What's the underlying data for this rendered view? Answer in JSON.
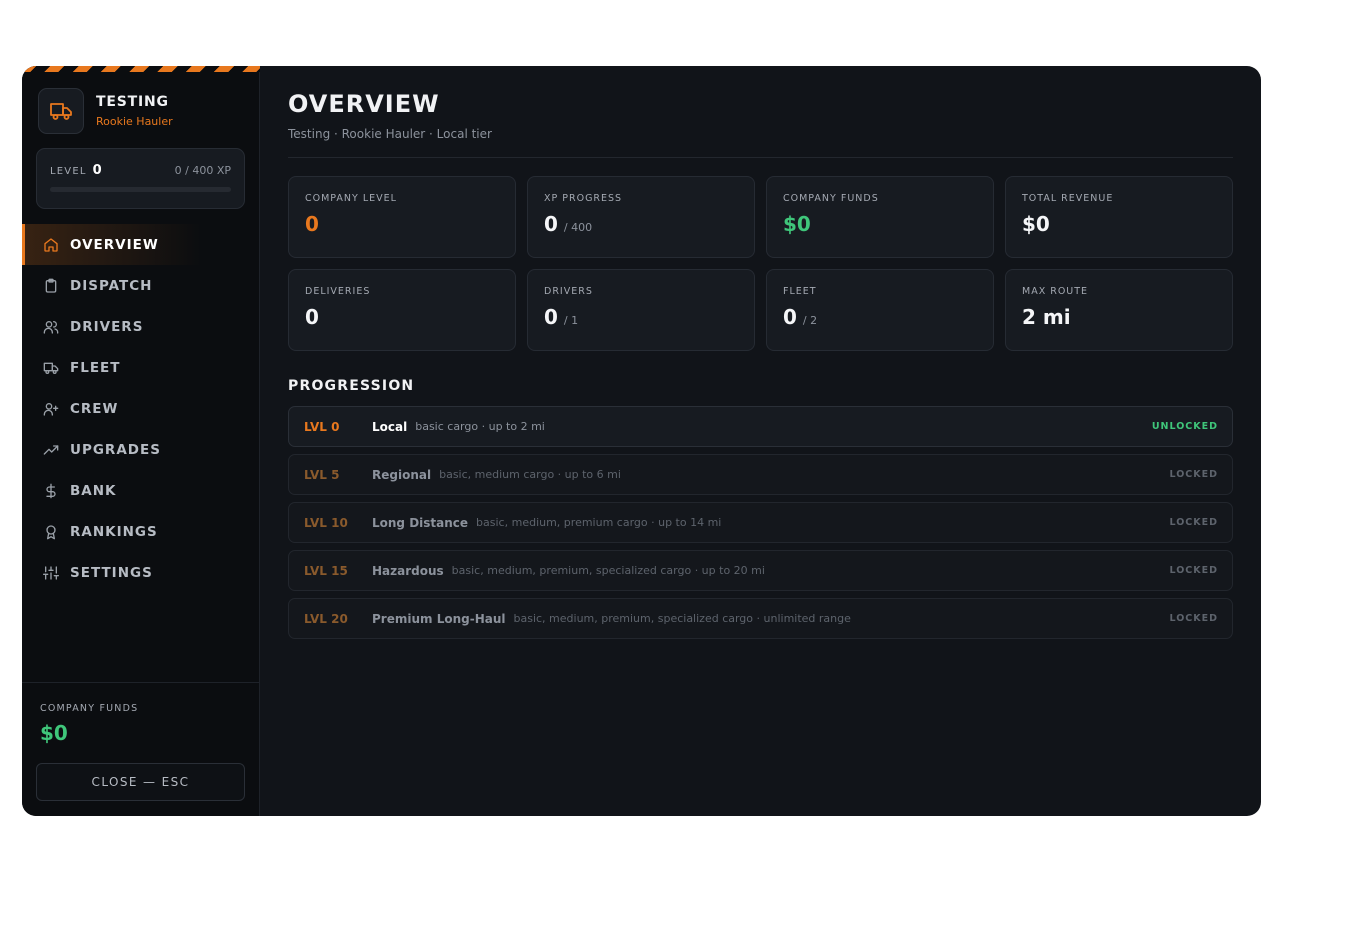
{
  "brand": {
    "name": "TESTING",
    "rank": "Rookie Hauler",
    "icon": "truck-icon"
  },
  "level": {
    "label": "LEVEL",
    "value": "0",
    "xp": "0 / 400 XP",
    "progress": 0
  },
  "nav": [
    {
      "label": "OVERVIEW",
      "icon": "home-icon",
      "active": true
    },
    {
      "label": "DISPATCH",
      "icon": "clipboard-icon"
    },
    {
      "label": "DRIVERS",
      "icon": "users-icon"
    },
    {
      "label": "FLEET",
      "icon": "truck-icon"
    },
    {
      "label": "CREW",
      "icon": "user-plus-icon"
    },
    {
      "label": "UPGRADES",
      "icon": "trending-up-icon"
    },
    {
      "label": "BANK",
      "icon": "dollar-icon"
    },
    {
      "label": "RANKINGS",
      "icon": "award-icon"
    },
    {
      "label": "SETTINGS",
      "icon": "sliders-icon"
    }
  ],
  "sidebar_footer": {
    "funds_label": "COMPANY FUNDS",
    "funds_value": "$0",
    "close_label": "CLOSE — ESC"
  },
  "page": {
    "title": "OVERVIEW",
    "subtitle": "Testing · Rookie Hauler · Local tier"
  },
  "stats": [
    {
      "label": "COMPANY LEVEL",
      "value": "0",
      "suffix": ""
    },
    {
      "label": "XP PROGRESS",
      "value": "0",
      "suffix": "/ 400"
    },
    {
      "label": "COMPANY FUNDS",
      "value": "$0",
      "suffix": ""
    },
    {
      "label": "TOTAL REVENUE",
      "value": "$0",
      "suffix": ""
    },
    {
      "label": "DELIVERIES",
      "value": "0",
      "suffix": ""
    },
    {
      "label": "DRIVERS",
      "value": "0",
      "suffix": "/ 1"
    },
    {
      "label": "FLEET",
      "value": "0",
      "suffix": "/ 2"
    },
    {
      "label": "MAX ROUTE",
      "value": "2 mi",
      "suffix": ""
    }
  ],
  "progression": {
    "title": "PROGRESSION",
    "tiers": [
      {
        "level": "LVL 0",
        "name": "Local",
        "desc": "basic cargo · up to 2 mi",
        "status": "UNLOCKED"
      },
      {
        "level": "LVL 5",
        "name": "Regional",
        "desc": "basic, medium cargo · up to 6 mi",
        "status": "LOCKED"
      },
      {
        "level": "LVL 10",
        "name": "Long Distance",
        "desc": "basic, medium, premium cargo · up to 14 mi",
        "status": "LOCKED"
      },
      {
        "level": "LVL 15",
        "name": "Hazardous",
        "desc": "basic, medium, premium, specialized cargo · up to 20 mi",
        "status": "LOCKED"
      },
      {
        "level": "LVL 20",
        "name": "Premium Long-Haul",
        "desc": "basic, medium, premium, specialized cargo · unlimited range",
        "status": "LOCKED"
      }
    ]
  },
  "colors": {
    "accent": "#e8781e",
    "money": "#3fc67a",
    "background": "#111419",
    "sidebar": "#0b0d10"
  }
}
